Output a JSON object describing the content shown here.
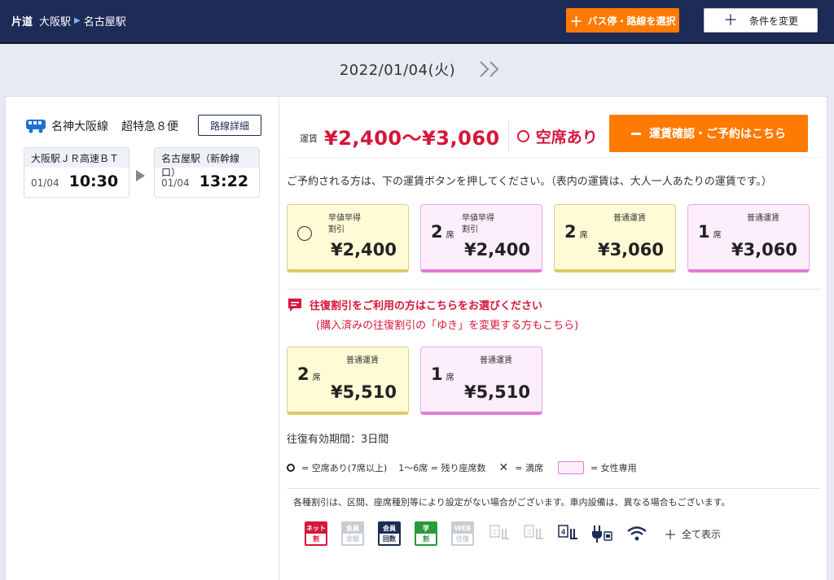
{
  "header": {
    "trip_type": "片道",
    "from": "大阪駅",
    "to": "名古屋駅",
    "select_button": "バス停・路線を選択",
    "change_button": "条件を変更"
  },
  "date": {
    "value": "2022/01/04(火)"
  },
  "service": {
    "line_name": "名神大阪線",
    "service_name": "超特急８便",
    "detail_button": "路線詳細",
    "depart": {
      "stop": "大阪駅ＪＲ高速ＢＴ",
      "date": "01/04",
      "time": "10:30"
    },
    "arrive": {
      "stop": "名古屋駅（新幹線口）",
      "date": "01/04",
      "time": "13:22"
    }
  },
  "fare": {
    "label": "運賃",
    "range": "¥2,400～¥3,060",
    "availability": "空席あり",
    "book_button": "運賃確認・ご予約はこちら",
    "instruction": "ご予約される方は、下の運賃ボタンを押してください。（表内の運賃は、大人一人あたりの運賃です。）"
  },
  "one_way_fares": [
    {
      "cat1": "早値早得",
      "cat2": "割引",
      "seats": "",
      "unit": "",
      "price": "¥2,400"
    },
    {
      "cat1": "早値早得",
      "cat2": "割引",
      "seats": "2",
      "unit": "席",
      "price": "¥2,400"
    },
    {
      "cat1": "普通運賃",
      "cat2": "",
      "seats": "2",
      "unit": "席",
      "price": "¥3,060"
    },
    {
      "cat1": "普通運賃",
      "cat2": "",
      "seats": "1",
      "unit": "席",
      "price": "¥3,060"
    }
  ],
  "round_trip": {
    "title": "往復割引をご利用の方はこちらをお選びください",
    "subtitle": "(購入済みの往復割引の「ゆき」を変更する方もこちら)",
    "fares": [
      {
        "cat1": "普通運賃",
        "seats": "2",
        "unit": "席",
        "price": "¥5,510"
      },
      {
        "cat1": "普通運賃",
        "seats": "1",
        "unit": "席",
        "price": "¥5,510"
      }
    ],
    "validity": "往復有効期間：3日間"
  },
  "legend": {
    "available": "= 空席あり(7席以上)",
    "remaining": "1～6席 = 残り座席数",
    "full": "= 満席",
    "women": "= 女性専用"
  },
  "notes": "各種割引は、区間、座席種別等により設定がない場合がございます。車内設備は、異なる場合もございます。",
  "discount_icons": [
    {
      "top": "ネット",
      "bottom": "割"
    },
    {
      "top": "会員",
      "bottom": "金額"
    },
    {
      "top": "会員",
      "bottom": "回数"
    },
    {
      "top": "学",
      "bottom": "割"
    },
    {
      "top": "WEB",
      "bottom": "往復"
    }
  ],
  "facility_icons": {
    "seat2": "2",
    "seat3": "3",
    "seat4": "4"
  },
  "show_all": "全て表示",
  "colors": {
    "navy": "#1d2b57",
    "orange": "#ff7a00",
    "red": "#d6163a"
  }
}
